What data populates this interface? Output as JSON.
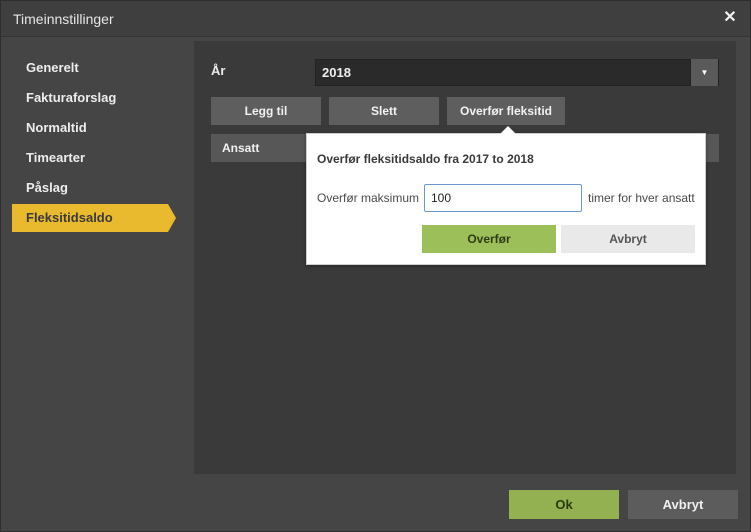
{
  "window": {
    "title": "Timeinnstillinger",
    "close_glyph": "✕"
  },
  "sidebar": {
    "items": [
      {
        "label": "Generelt",
        "active": false
      },
      {
        "label": "Fakturaforslag",
        "active": false
      },
      {
        "label": "Normaltid",
        "active": false
      },
      {
        "label": "Timearter",
        "active": false
      },
      {
        "label": "Påslag",
        "active": false
      },
      {
        "label": "Fleksitidsaldo",
        "active": true
      }
    ]
  },
  "main": {
    "year_label": "År",
    "year_value": "2018",
    "caret_glyph": "▼",
    "toolbar": {
      "add_label": "Legg til",
      "delete_label": "Slett",
      "transfer_label": "Overfør fleksitid"
    },
    "table": {
      "columns": [
        "Ansatt"
      ]
    }
  },
  "popup": {
    "title": "Overfør fleksitidsaldo fra 2017 to 2018",
    "max_label": "Overfør maksimum",
    "max_value": "100",
    "unit_label": "timer for hver ansatt",
    "transfer_button": "Overfør",
    "cancel_button": "Avbryt"
  },
  "footer": {
    "ok_label": "Ok",
    "cancel_label": "Avbryt"
  },
  "colors": {
    "accent_active": "#e9b92e",
    "ok_green": "#93b151",
    "popup_ok_green": "#9dbf5a",
    "background": "#454545",
    "panel": "#3a3a3a"
  }
}
